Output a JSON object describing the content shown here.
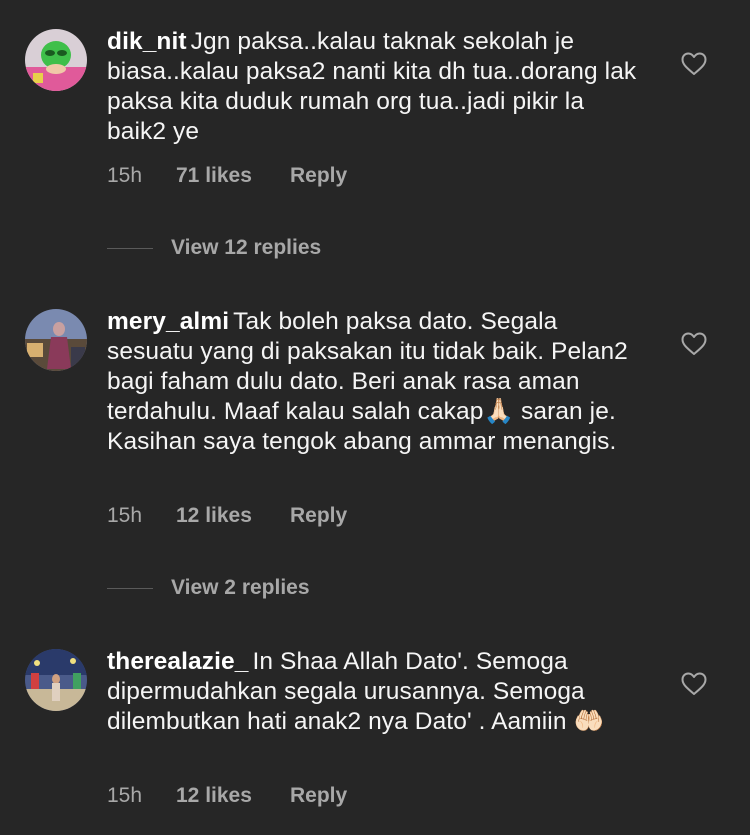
{
  "comments": [
    {
      "username": "dik_nit",
      "text": "Jgn paksa..kalau taknak sekolah je biasa..kalau paksa2 nanti kita dh tua..dorang lak paksa kita duduk rumah org tua..jadi pikir la baik2 ye",
      "time": "15h",
      "likes": "71 likes",
      "reply": "Reply",
      "view_replies": "View 12 replies"
    },
    {
      "username": "mery_almi",
      "text": "Tak boleh paksa dato. Segala sesuatu yang di paksakan itu tidak baik. Pelan2 bagi faham dulu dato. Beri anak rasa aman terdahulu. Maaf kalau salah cakap🙏🏻 saran je. Kasihan saya tengok abang ammar menangis.",
      "time": "15h",
      "likes": "12 likes",
      "reply": "Reply",
      "view_replies": "View 2 replies"
    },
    {
      "username": "therealazie_",
      "text": "In Shaa Allah Dato'. Semoga dipermudahkan segala urusannya. Semoga dilembutkan hati anak2 nya Dato' . Aamiin 🤲🏻",
      "time": "15h",
      "likes": "12 likes",
      "reply": "Reply"
    }
  ],
  "icons": {
    "like": "heart-outline-icon"
  },
  "colors": {
    "background": "#262626",
    "primary_text": "#f5f5f5",
    "secondary_text": "#a8a8a8"
  }
}
